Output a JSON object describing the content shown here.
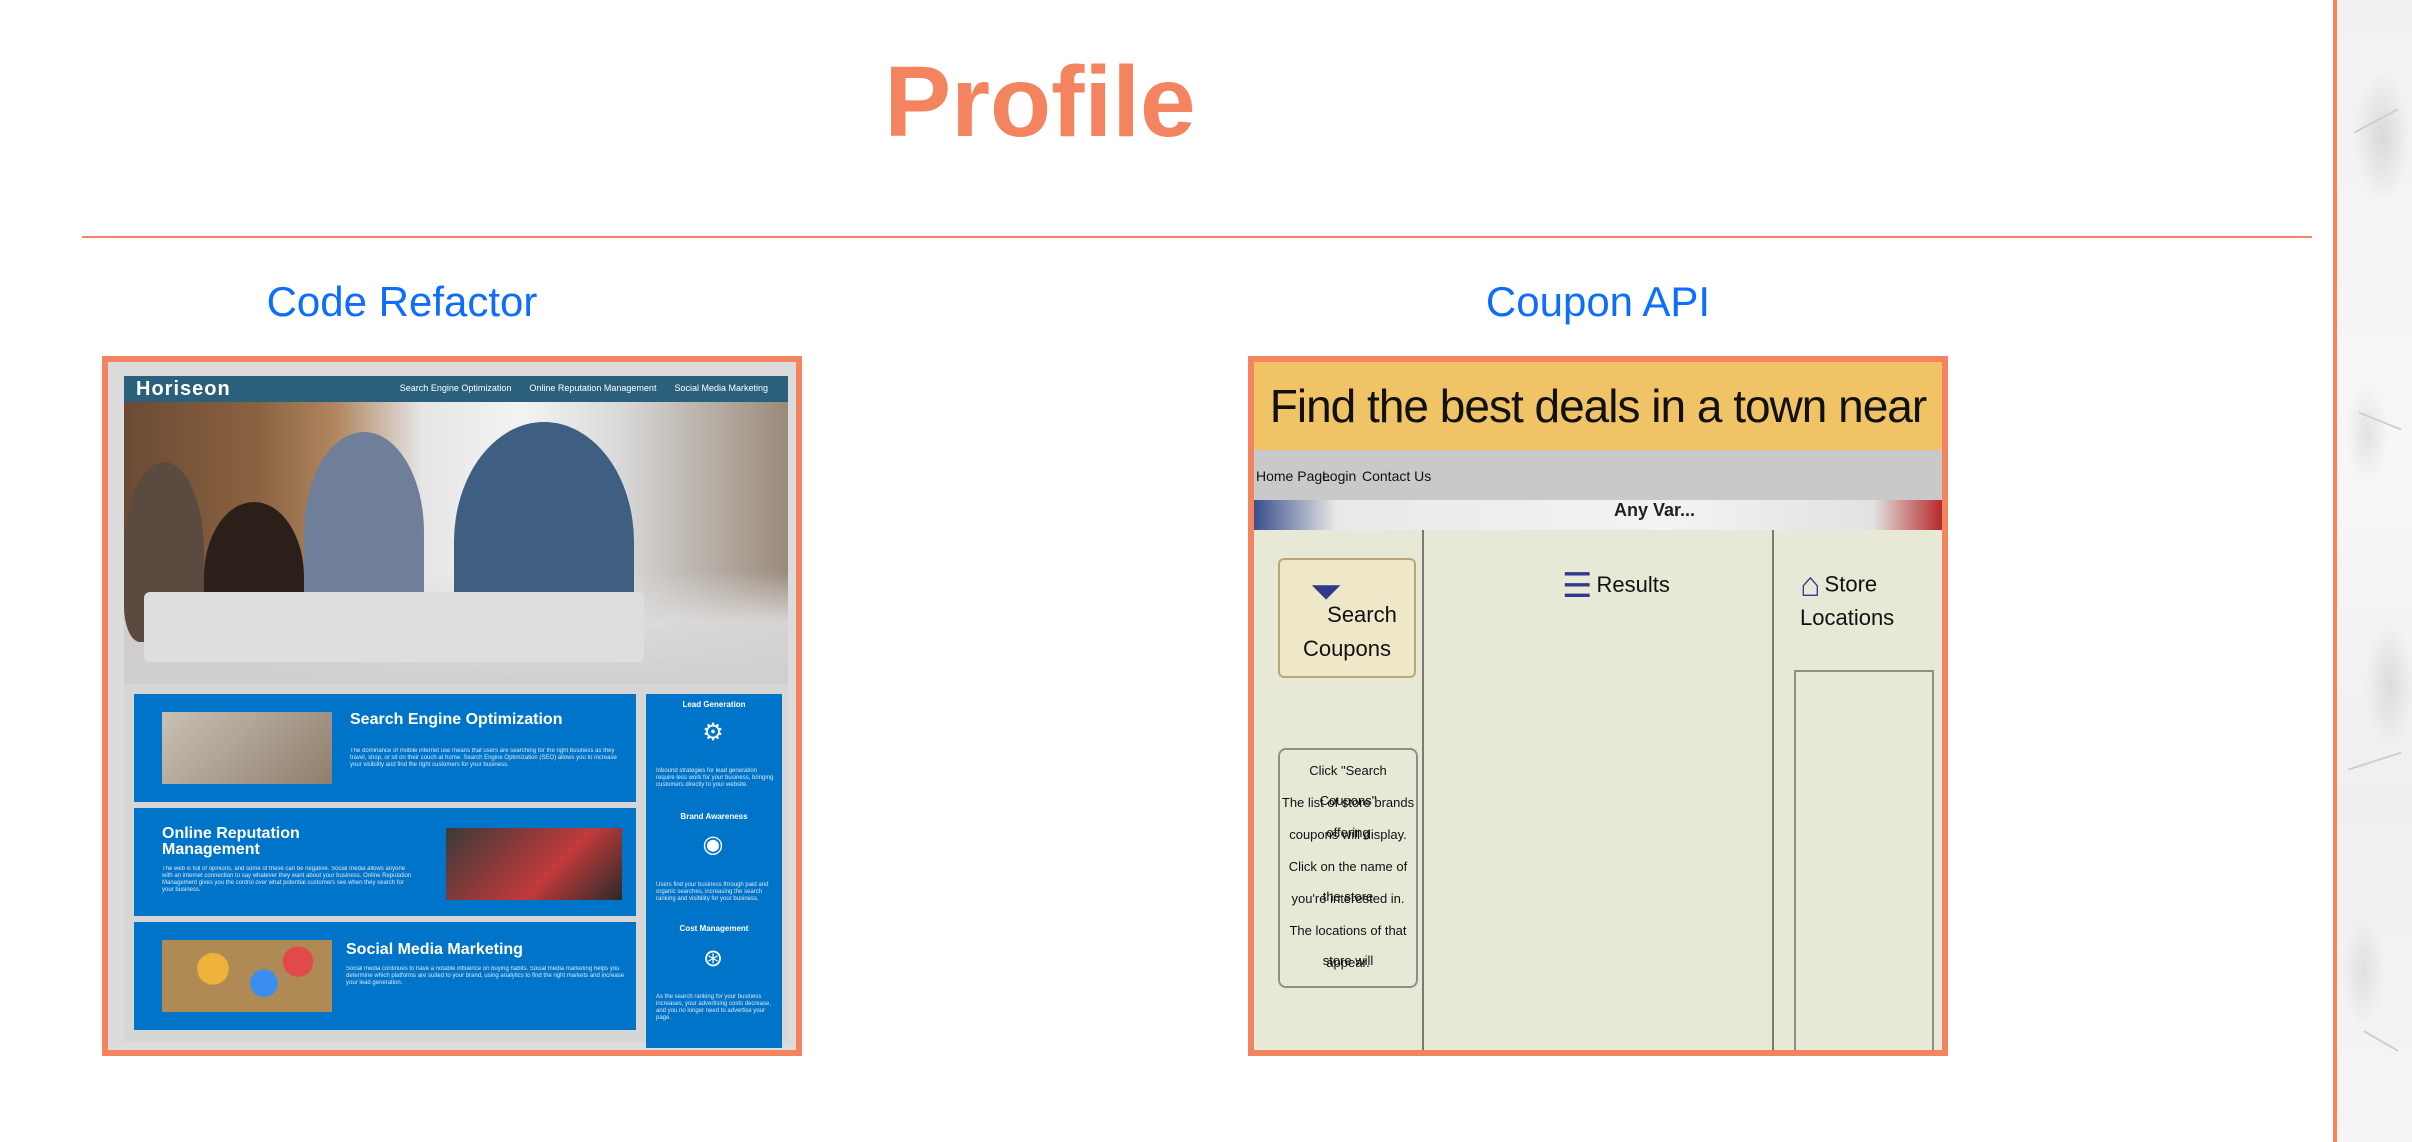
{
  "page": {
    "title": "Profile"
  },
  "colors": {
    "accent": "#f4845f",
    "link": "#0d6efd"
  },
  "projects": [
    {
      "title": "Code Refactor",
      "screenshot": {
        "logo": "Horiseon",
        "nav": [
          "Search Engine Optimization",
          "Online Reputation Management",
          "Social Media Marketing"
        ],
        "cards": [
          {
            "title": "Search Engine Optimization",
            "body": "The dominance of mobile internet use means that users are searching for the right business as they travel, shop, or sit on their couch at home. Search Engine Optimization (SEO) allows you to increase your visibility and find the right customers for your business."
          },
          {
            "title": "Online Reputation Management",
            "body": "The web is full of opinions, and some of these can be negative. Social media allows anyone with an internet connection to say whatever they want about your business. Online Reputation Management gives you the control over what potential customers see when they search for your business."
          },
          {
            "title": "Social Media Marketing",
            "body": "Social media continues to have a notable influence on buying habits. Social media marketing helps you determine which platforms are suited to your brand, using analytics to find the right markets and increase your lead generation."
          }
        ],
        "aside": [
          {
            "title": "Lead Generation",
            "icon": "lead-icon",
            "body": "Inbound strategies for lead generation require less work for your business, bringing customers directly to your website."
          },
          {
            "title": "Brand Awareness",
            "icon": "broadcast-icon",
            "body": "Users find your business through paid and organic searches, increasing the search ranking and visibility for your business."
          },
          {
            "title": "Cost Management",
            "icon": "cost-icon",
            "body": "As the search ranking for your business increases, your advertising costs decrease, and you no longer need to advertise your page."
          }
        ]
      }
    },
    {
      "title": "Coupon API",
      "screenshot": {
        "header": "Find the best deals in a town near you!",
        "nav": [
          "Home Page",
          "Login",
          "Contact Us"
        ],
        "map_text": "Any Var...",
        "search_button": [
          "Search",
          "Coupons"
        ],
        "results_label": "Results",
        "stores_label": "Store Locations",
        "instructions": [
          "Click \"Search Coupons\"",
          "The list of store brands offering",
          "coupons will display.",
          "Click on the name of the store",
          "you're interested in.",
          "The locations of that store will",
          "appear."
        ]
      }
    }
  ]
}
